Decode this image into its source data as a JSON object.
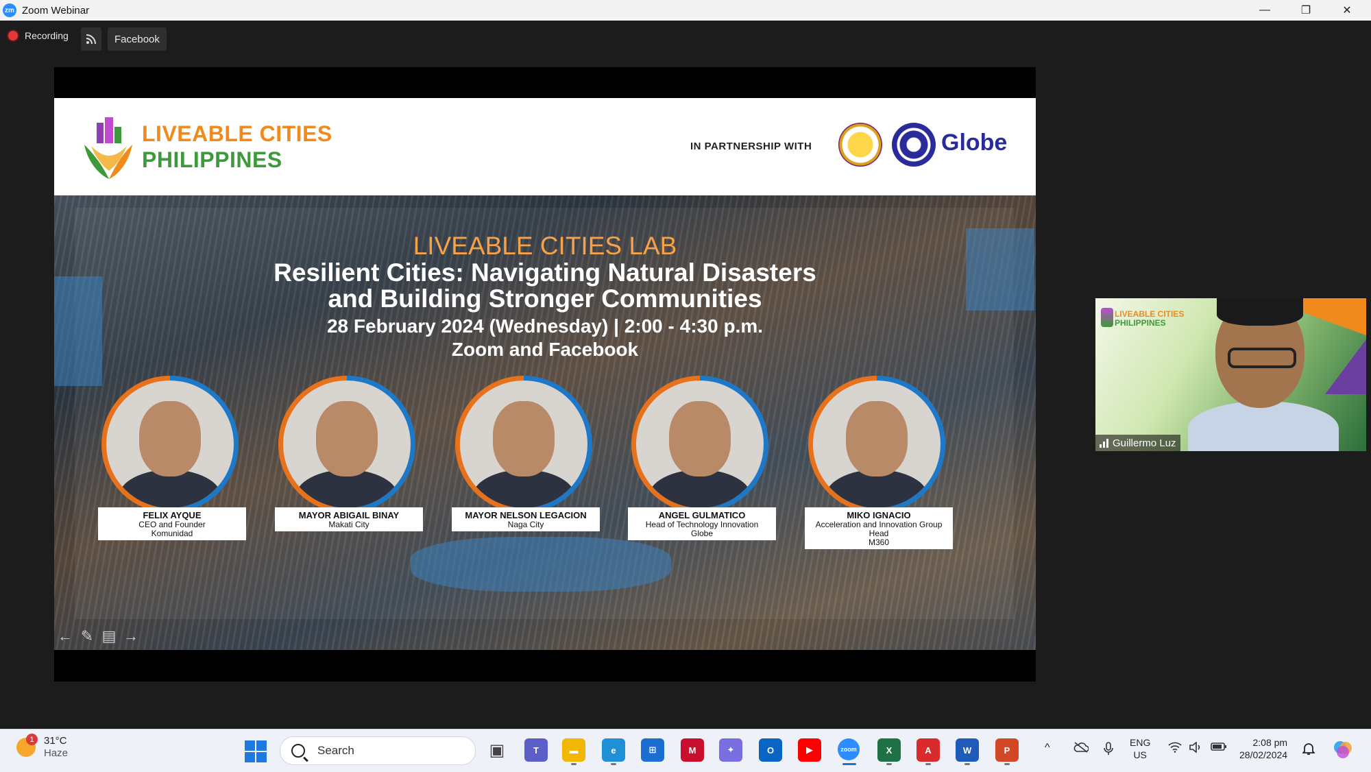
{
  "window": {
    "app_icon": "zm",
    "title": "Zoom Webinar",
    "controls": {
      "minimize": "—",
      "restore": "❐",
      "close": "✕"
    }
  },
  "zoom_toolbar": {
    "recording_label": "Recording",
    "rss_icon": "rss-icon",
    "stream_target": "Facebook"
  },
  "slide": {
    "logo_line1": "LIVEABLE CITIES",
    "logo_line2": "PHILIPPINES",
    "partnership_label": "IN PARTNERSHIP WITH",
    "partner_name": "Globe",
    "lab_title": "LIVEABLE CITIES LAB",
    "headline_line1": "Resilient Cities: Navigating Natural Disasters",
    "headline_line2": "and Building Stronger Communities",
    "date_time": "28 February 2024 (Wednesday) | 2:00 - 4:30 p.m.",
    "venue": "Zoom and Facebook",
    "speakers": [
      {
        "name": "FELIX AYQUE",
        "role_lines": [
          "CEO and Founder",
          "Komunidad"
        ]
      },
      {
        "name": "MAYOR ABIGAIL BINAY",
        "role_lines": [
          "Makati City"
        ]
      },
      {
        "name": "MAYOR NELSON LEGACION",
        "role_lines": [
          "Naga City"
        ]
      },
      {
        "name": "ANGEL GULMATICO",
        "role_lines": [
          "Head of Technology Innovation",
          "Globe"
        ]
      },
      {
        "name": "MIKO IGNACIO",
        "role_lines": [
          "Acceleration and Innovation Group Head",
          "M360"
        ]
      }
    ],
    "nav_controls": [
      "←",
      "✎",
      "▤",
      "→"
    ]
  },
  "participant": {
    "name": "Guillermo Luz",
    "bg_logo_line1": "LIVEABLE CITIES",
    "bg_logo_line2": "PHILIPPINES"
  },
  "taskbar": {
    "weather": {
      "temp": "31°C",
      "condition": "Haze",
      "badge": "1"
    },
    "search_label": "Search",
    "apps": [
      {
        "name": "task-view",
        "glyph": "▣",
        "color": "#444444"
      },
      {
        "name": "teams",
        "glyph": "T",
        "color": "#5b5fc7"
      },
      {
        "name": "file-explorer",
        "glyph": "▬",
        "color": "#f2b705"
      },
      {
        "name": "edge",
        "glyph": "e",
        "color": "#1f8fd6"
      },
      {
        "name": "store",
        "glyph": "⊞",
        "color": "#1c6fd0"
      },
      {
        "name": "mcafee",
        "glyph": "M",
        "color": "#c8102e"
      },
      {
        "name": "copilot-app",
        "glyph": "✦",
        "color": "#7a6fe0"
      },
      {
        "name": "outlook",
        "glyph": "O",
        "color": "#0a64c4"
      },
      {
        "name": "youtube",
        "glyph": "▶",
        "color": "#ff0000"
      },
      {
        "name": "zoom",
        "glyph": "zoom",
        "color": "#2d8cff"
      },
      {
        "name": "excel",
        "glyph": "X",
        "color": "#1e7145"
      },
      {
        "name": "acrobat",
        "glyph": "A",
        "color": "#d92b2b"
      },
      {
        "name": "word",
        "glyph": "W",
        "color": "#1f5bb8"
      },
      {
        "name": "powerpoint",
        "glyph": "P",
        "color": "#d24726"
      }
    ],
    "tray": {
      "chevron": "^",
      "lang1": "ENG",
      "lang2": "US",
      "time": "2:08 pm",
      "date": "28/02/2024"
    }
  }
}
